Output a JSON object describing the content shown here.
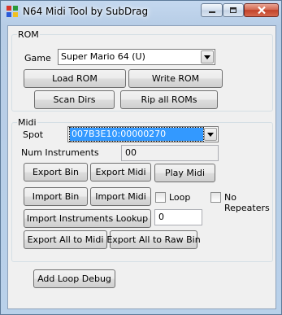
{
  "window": {
    "title": "N64 Midi Tool by SubDrag"
  },
  "rom_group": {
    "legend": "ROM",
    "game_label": "Game",
    "game_value": "Super Mario 64 (U)",
    "load_rom": "Load ROM",
    "write_rom": "Write ROM",
    "scan_dirs": "Scan Dirs",
    "rip_all_roms": "Rip all ROMs"
  },
  "midi_group": {
    "legend": "Midi",
    "spot_label": "Spot",
    "spot_value": "007B3E10:00000270",
    "num_instruments_label": "Num Instruments",
    "num_instruments_value": "00",
    "export_bin": "Export Bin",
    "export_midi": "Export Midi",
    "play_midi": "Play Midi",
    "import_bin": "Import Bin",
    "import_midi": "Import Midi",
    "loop_label": "Loop",
    "no_repeaters_label": "No Repeaters",
    "import_instruments_lookup": "Import Instruments Lookup",
    "lookup_value": "0",
    "export_all_to_midi": "Export All to Midi",
    "export_all_to_raw_bin": "Export All to Raw Bin"
  },
  "add_loop_debug": "Add Loop Debug",
  "colors": {
    "frame": "#b9d1ea",
    "client": "#f0f0f0",
    "selection": "#3399ff",
    "close_button": "#c2422a"
  }
}
